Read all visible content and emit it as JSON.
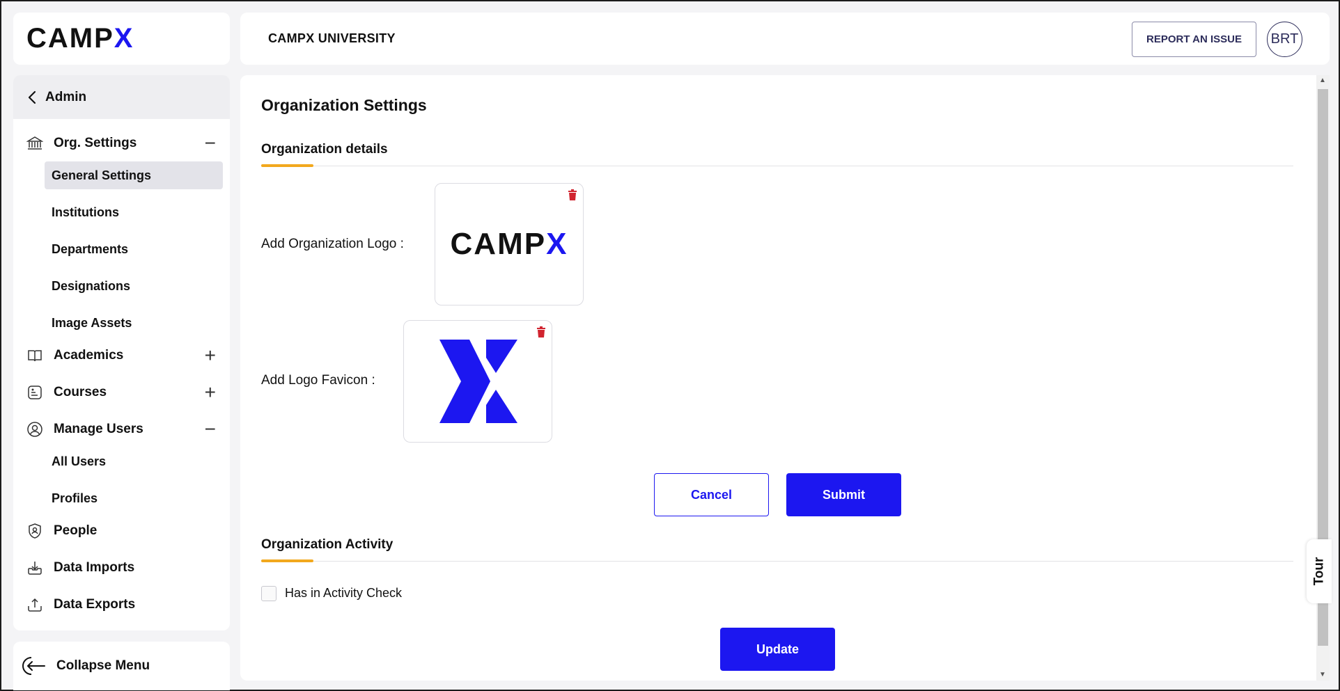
{
  "brand": {
    "name_main": "CAMP",
    "name_x": "X"
  },
  "header": {
    "title": "CAMPX UNIVERSITY",
    "report_button": "REPORT AN ISSUE",
    "avatar_initials": "BRT"
  },
  "sidebar": {
    "back_label": "Admin",
    "org_settings": {
      "label": "Org. Settings",
      "toggle": "−",
      "items": [
        "General Settings",
        "Institutions",
        "Departments",
        "Designations",
        "Image Assets"
      ]
    },
    "academics": {
      "label": "Academics",
      "toggle": "+"
    },
    "courses": {
      "label": "Courses",
      "toggle": "+"
    },
    "manage_users": {
      "label": "Manage Users",
      "toggle": "−",
      "items": [
        "All Users",
        "Profiles"
      ]
    },
    "people": {
      "label": "People"
    },
    "data_imports": {
      "label": "Data Imports"
    },
    "data_exports": {
      "label": "Data Exports"
    },
    "collapse_label": "Collapse Menu"
  },
  "main": {
    "page_title": "Organization Settings",
    "details_section": {
      "title": "Organization details",
      "logo_label": "Add Organization Logo :",
      "favicon_label": "Add Logo Favicon :",
      "cancel_label": "Cancel",
      "submit_label": "Submit"
    },
    "activity_section": {
      "title": "Organization Activity",
      "checkbox_label": "Has in Activity Check",
      "checkbox_checked": false,
      "update_label": "Update"
    }
  },
  "tour_label": "Tour",
  "colors": {
    "accent": "#1c17f0",
    "underline": "#f2a81d",
    "delete": "#d1242f"
  }
}
